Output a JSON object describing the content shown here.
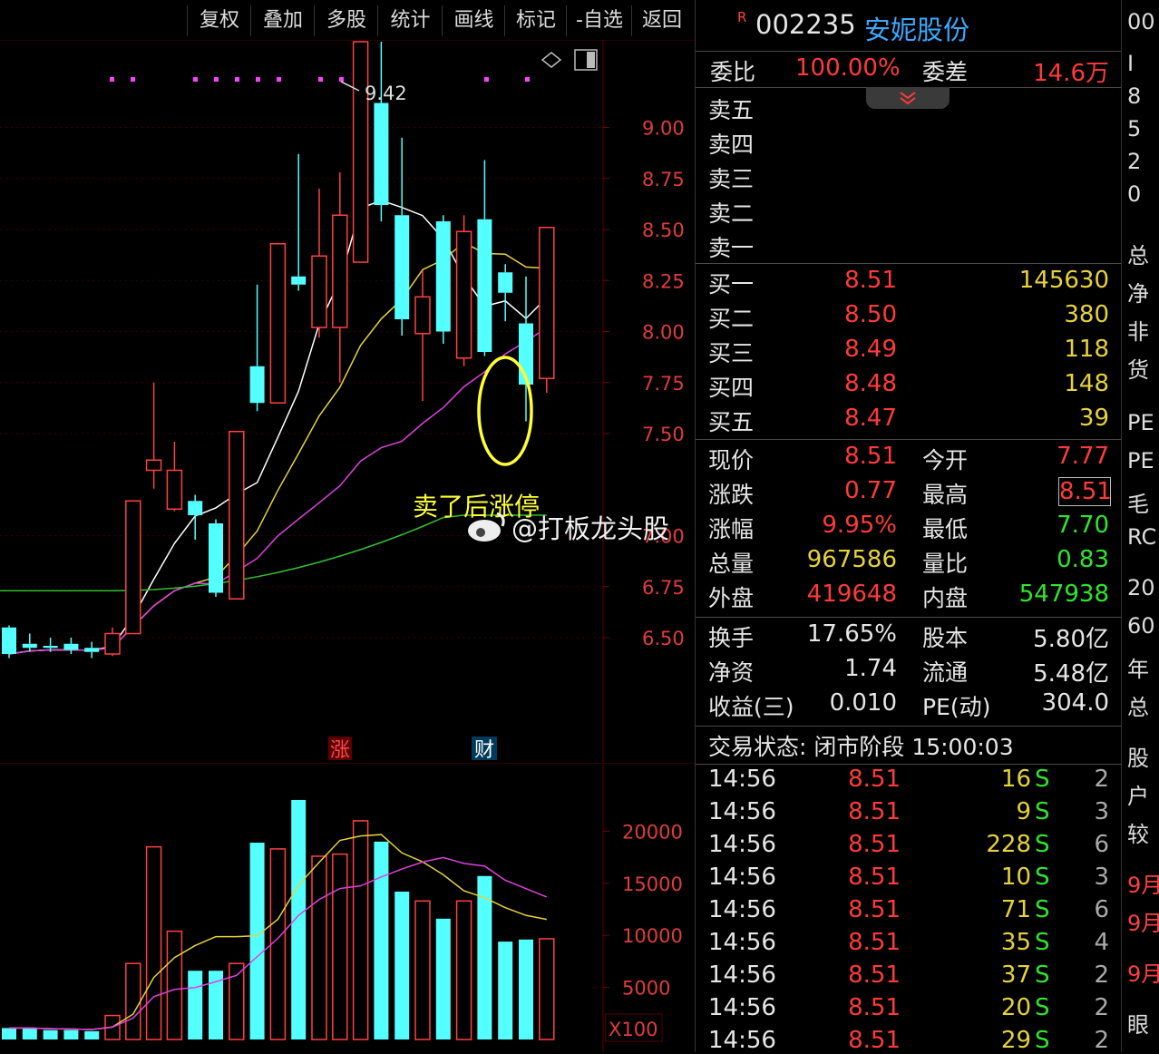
{
  "toolbar": {
    "buttons": [
      "复权",
      "叠加",
      "多股",
      "统计",
      "画线",
      "标记",
      "-自选",
      "返回"
    ]
  },
  "kline": {
    "high_marker": "9.42",
    "price_ticks": [
      "9.00",
      "8.75",
      "8.50",
      "8.25",
      "8.00",
      "7.75",
      "7.50",
      "7.00",
      "6.75",
      "6.50"
    ],
    "badge_zhang": "涨",
    "badge_cai": "财",
    "annotation": "卖了后涨停",
    "watermark": "@打板龙头股",
    "colors": {
      "up": "#ff4040",
      "down": "#54ffff",
      "ma5": "#ffffff",
      "ma10": "#e6d23c",
      "ma20": "#e040e0",
      "ma60": "#30c030",
      "annotation": "#ffff33"
    }
  },
  "volume": {
    "ticks": [
      "20000",
      "15000",
      "10000",
      "5000"
    ],
    "unit": "X100"
  },
  "quote": {
    "code": "002235",
    "name": "安妮股份",
    "r_mark": "R",
    "weibi_label": "委比",
    "weibi_value": "100.00%",
    "weicha_label": "委差",
    "weicha_value": "14.6万",
    "asks": [
      {
        "label": "卖五"
      },
      {
        "label": "卖四"
      },
      {
        "label": "卖三"
      },
      {
        "label": "卖二"
      },
      {
        "label": "卖一"
      }
    ],
    "bids": [
      {
        "label": "买一",
        "price": "8.51",
        "vol": "145630"
      },
      {
        "label": "买二",
        "price": "8.50",
        "vol": "380"
      },
      {
        "label": "买三",
        "price": "8.49",
        "vol": "118"
      },
      {
        "label": "买四",
        "price": "8.48",
        "vol": "148"
      },
      {
        "label": "买五",
        "price": "8.47",
        "vol": "39"
      }
    ],
    "stats_left": [
      {
        "label": "现价",
        "value": "8.51"
      },
      {
        "label": "涨跌",
        "value": "0.77"
      },
      {
        "label": "涨幅",
        "value": "9.95%"
      },
      {
        "label": "总量",
        "value": "967586"
      },
      {
        "label": "外盘",
        "value": "419648"
      }
    ],
    "stats_right": [
      {
        "label": "今开",
        "value": "7.77"
      },
      {
        "label": "最高",
        "value": "8.51"
      },
      {
        "label": "最低",
        "value": "7.70"
      },
      {
        "label": "量比",
        "value": "0.83"
      },
      {
        "label": "内盘",
        "value": "547938"
      }
    ],
    "fund_left": [
      {
        "label": "换手",
        "value": "17.65%"
      },
      {
        "label": "净资",
        "value": "1.74"
      },
      {
        "label": "收益(三)",
        "value": "0.010"
      }
    ],
    "fund_right": [
      {
        "label": "股本",
        "value": "5.80亿"
      },
      {
        "label": "流通",
        "value": "5.48亿"
      },
      {
        "label": "PE(动)",
        "value": "304.0"
      }
    ],
    "status": "交易状态: 闭市阶段 15:00:03",
    "ticks": [
      {
        "time": "14:56",
        "price": "8.51",
        "vol": "16",
        "side": "S",
        "n": "2"
      },
      {
        "time": "14:56",
        "price": "8.51",
        "vol": "9",
        "side": "S",
        "n": "3"
      },
      {
        "time": "14:56",
        "price": "8.51",
        "vol": "228",
        "side": "S",
        "n": "6"
      },
      {
        "time": "14:56",
        "price": "8.51",
        "vol": "10",
        "side": "S",
        "n": "3"
      },
      {
        "time": "14:56",
        "price": "8.51",
        "vol": "71",
        "side": "S",
        "n": "6"
      },
      {
        "time": "14:56",
        "price": "8.51",
        "vol": "35",
        "side": "S",
        "n": "4"
      },
      {
        "time": "14:56",
        "price": "8.51",
        "vol": "37",
        "side": "S",
        "n": "2"
      },
      {
        "time": "14:56",
        "price": "8.51",
        "vol": "20",
        "side": "S",
        "n": "2"
      },
      {
        "time": "14:56",
        "price": "8.51",
        "vol": "29",
        "side": "S",
        "n": "2"
      }
    ]
  },
  "far_right": {
    "items": [
      "00",
      "I",
      "8",
      "5",
      "2",
      "0",
      "总",
      "净",
      "非",
      "货",
      "PE",
      "PE",
      "毛",
      "RC",
      "20",
      "60",
      "年",
      "总",
      "股",
      "户",
      "较",
      "9月",
      "9月",
      "9月",
      "眼"
    ]
  },
  "chart_data": {
    "type": "candlestick",
    "price_axis": {
      "ticks": [
        9.0,
        8.75,
        8.5,
        8.25,
        8.0,
        7.75,
        7.5,
        7.0,
        6.75,
        6.5
      ]
    },
    "high_label": 9.42,
    "candles": [
      {
        "o": 6.55,
        "c": 6.42,
        "h": 6.56,
        "l": 6.4,
        "vol": 1100
      },
      {
        "o": 6.47,
        "c": 6.45,
        "h": 6.52,
        "l": 6.43,
        "vol": 1100
      },
      {
        "o": 6.46,
        "c": 6.45,
        "h": 6.5,
        "l": 6.43,
        "vol": 900
      },
      {
        "o": 6.47,
        "c": 6.44,
        "h": 6.5,
        "l": 6.42,
        "vol": 900
      },
      {
        "o": 6.45,
        "c": 6.43,
        "h": 6.48,
        "l": 6.4,
        "vol": 800
      },
      {
        "o": 6.42,
        "c": 6.52,
        "h": 6.55,
        "l": 6.41,
        "vol": 2300
      },
      {
        "o": 6.52,
        "c": 7.17,
        "h": 7.17,
        "l": 6.52,
        "vol": 7300
      },
      {
        "o": 7.32,
        "c": 7.37,
        "h": 7.75,
        "l": 7.23,
        "vol": 18500
      },
      {
        "o": 7.13,
        "c": 7.32,
        "h": 7.46,
        "l": 7.12,
        "vol": 10400
      },
      {
        "o": 7.17,
        "c": 7.1,
        "h": 7.2,
        "l": 6.98,
        "vol": 6600
      },
      {
        "o": 7.06,
        "c": 6.72,
        "h": 7.08,
        "l": 6.7,
        "vol": 6600
      },
      {
        "o": 6.69,
        "c": 7.51,
        "h": 7.51,
        "l": 6.69,
        "vol": 7300
      },
      {
        "o": 7.83,
        "c": 7.65,
        "h": 8.23,
        "l": 7.61,
        "vol": 18900
      },
      {
        "o": 7.65,
        "c": 8.43,
        "h": 8.43,
        "l": 7.65,
        "vol": 18300
      },
      {
        "o": 8.27,
        "c": 8.23,
        "h": 8.87,
        "l": 8.2,
        "vol": 23000
      },
      {
        "o": 8.02,
        "c": 8.37,
        "h": 8.7,
        "l": 7.97,
        "vol": 17600
      },
      {
        "o": 8.02,
        "c": 8.57,
        "h": 8.78,
        "l": 7.75,
        "vol": 17800
      },
      {
        "o": 8.34,
        "c": 9.42,
        "h": 9.42,
        "l": 8.34,
        "vol": 21000
      },
      {
        "o": 9.12,
        "c": 8.62,
        "h": 9.42,
        "l": 8.54,
        "vol": 19000
      },
      {
        "o": 8.57,
        "c": 8.06,
        "h": 8.95,
        "l": 7.98,
        "vol": 14200
      },
      {
        "o": 7.99,
        "c": 8.17,
        "h": 8.3,
        "l": 7.66,
        "vol": 13300
      },
      {
        "o": 8.54,
        "c": 8.0,
        "h": 8.57,
        "l": 7.94,
        "vol": 11600
      },
      {
        "o": 7.87,
        "c": 8.49,
        "h": 8.57,
        "l": 7.83,
        "vol": 13300
      },
      {
        "o": 8.55,
        "c": 7.9,
        "h": 8.84,
        "l": 7.88,
        "vol": 15700
      },
      {
        "o": 8.29,
        "c": 8.19,
        "h": 8.33,
        "l": 8.05,
        "vol": 9400
      },
      {
        "o": 8.04,
        "c": 7.74,
        "h": 8.27,
        "l": 7.56,
        "vol": 9600
      },
      {
        "o": 7.77,
        "c": 8.51,
        "h": 8.51,
        "l": 7.7,
        "vol": 9675
      }
    ],
    "volume_axis": {
      "ticks": [
        20000,
        15000,
        10000,
        5000
      ],
      "unit": "X100"
    }
  }
}
